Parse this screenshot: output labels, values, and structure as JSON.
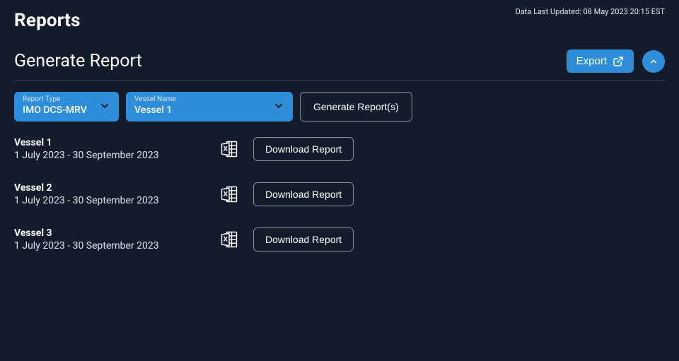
{
  "header": {
    "title": "Reports",
    "last_updated": "Data Last Updated: 08 May 2023 20:15 EST"
  },
  "section": {
    "title": "Generate Report",
    "export_label": "Export"
  },
  "controls": {
    "report_type": {
      "label": "Report Type",
      "value": "IMO DCS-MRV"
    },
    "vessel_name": {
      "label": "Vessel Name",
      "value": "Vessel 1"
    },
    "generate_label": "Generate Report(s)"
  },
  "results": [
    {
      "name": "Vessel 1",
      "range": "1 July 2023 - 30 September 2023",
      "download_label": "Download Report"
    },
    {
      "name": "Vessel 2",
      "range": "1 July 2023 - 30 September 2023",
      "download_label": "Download Report"
    },
    {
      "name": "Vessel 3",
      "range": "1 July 2023 - 30 September 2023",
      "download_label": "Download Report"
    }
  ]
}
